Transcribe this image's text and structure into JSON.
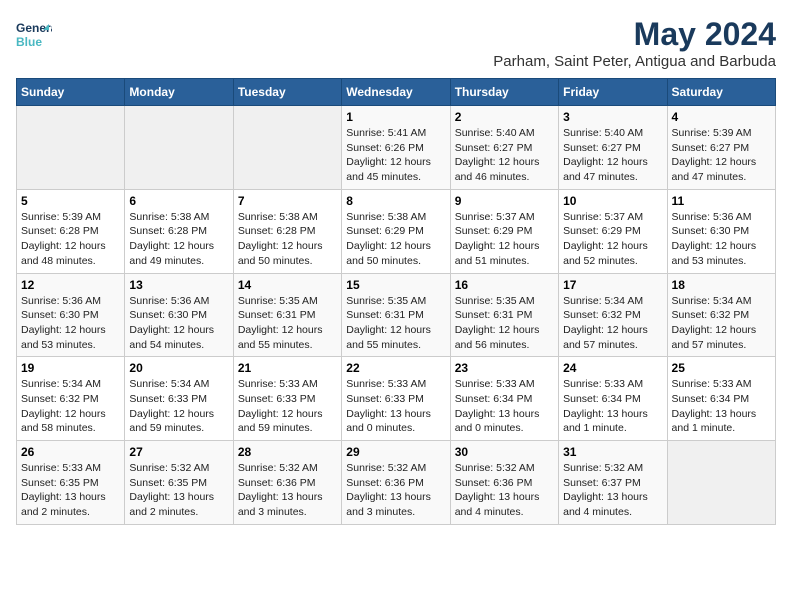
{
  "logo": {
    "line1": "General",
    "line2": "Blue"
  },
  "title": "May 2024",
  "location": "Parham, Saint Peter, Antigua and Barbuda",
  "days_of_week": [
    "Sunday",
    "Monday",
    "Tuesday",
    "Wednesday",
    "Thursday",
    "Friday",
    "Saturday"
  ],
  "weeks": [
    [
      {
        "day": "",
        "info": ""
      },
      {
        "day": "",
        "info": ""
      },
      {
        "day": "",
        "info": ""
      },
      {
        "day": "1",
        "info": "Sunrise: 5:41 AM\nSunset: 6:26 PM\nDaylight: 12 hours\nand 45 minutes."
      },
      {
        "day": "2",
        "info": "Sunrise: 5:40 AM\nSunset: 6:27 PM\nDaylight: 12 hours\nand 46 minutes."
      },
      {
        "day": "3",
        "info": "Sunrise: 5:40 AM\nSunset: 6:27 PM\nDaylight: 12 hours\nand 47 minutes."
      },
      {
        "day": "4",
        "info": "Sunrise: 5:39 AM\nSunset: 6:27 PM\nDaylight: 12 hours\nand 47 minutes."
      }
    ],
    [
      {
        "day": "5",
        "info": "Sunrise: 5:39 AM\nSunset: 6:28 PM\nDaylight: 12 hours\nand 48 minutes."
      },
      {
        "day": "6",
        "info": "Sunrise: 5:38 AM\nSunset: 6:28 PM\nDaylight: 12 hours\nand 49 minutes."
      },
      {
        "day": "7",
        "info": "Sunrise: 5:38 AM\nSunset: 6:28 PM\nDaylight: 12 hours\nand 50 minutes."
      },
      {
        "day": "8",
        "info": "Sunrise: 5:38 AM\nSunset: 6:29 PM\nDaylight: 12 hours\nand 50 minutes."
      },
      {
        "day": "9",
        "info": "Sunrise: 5:37 AM\nSunset: 6:29 PM\nDaylight: 12 hours\nand 51 minutes."
      },
      {
        "day": "10",
        "info": "Sunrise: 5:37 AM\nSunset: 6:29 PM\nDaylight: 12 hours\nand 52 minutes."
      },
      {
        "day": "11",
        "info": "Sunrise: 5:36 AM\nSunset: 6:30 PM\nDaylight: 12 hours\nand 53 minutes."
      }
    ],
    [
      {
        "day": "12",
        "info": "Sunrise: 5:36 AM\nSunset: 6:30 PM\nDaylight: 12 hours\nand 53 minutes."
      },
      {
        "day": "13",
        "info": "Sunrise: 5:36 AM\nSunset: 6:30 PM\nDaylight: 12 hours\nand 54 minutes."
      },
      {
        "day": "14",
        "info": "Sunrise: 5:35 AM\nSunset: 6:31 PM\nDaylight: 12 hours\nand 55 minutes."
      },
      {
        "day": "15",
        "info": "Sunrise: 5:35 AM\nSunset: 6:31 PM\nDaylight: 12 hours\nand 55 minutes."
      },
      {
        "day": "16",
        "info": "Sunrise: 5:35 AM\nSunset: 6:31 PM\nDaylight: 12 hours\nand 56 minutes."
      },
      {
        "day": "17",
        "info": "Sunrise: 5:34 AM\nSunset: 6:32 PM\nDaylight: 12 hours\nand 57 minutes."
      },
      {
        "day": "18",
        "info": "Sunrise: 5:34 AM\nSunset: 6:32 PM\nDaylight: 12 hours\nand 57 minutes."
      }
    ],
    [
      {
        "day": "19",
        "info": "Sunrise: 5:34 AM\nSunset: 6:32 PM\nDaylight: 12 hours\nand 58 minutes."
      },
      {
        "day": "20",
        "info": "Sunrise: 5:34 AM\nSunset: 6:33 PM\nDaylight: 12 hours\nand 59 minutes."
      },
      {
        "day": "21",
        "info": "Sunrise: 5:33 AM\nSunset: 6:33 PM\nDaylight: 12 hours\nand 59 minutes."
      },
      {
        "day": "22",
        "info": "Sunrise: 5:33 AM\nSunset: 6:33 PM\nDaylight: 13 hours\nand 0 minutes."
      },
      {
        "day": "23",
        "info": "Sunrise: 5:33 AM\nSunset: 6:34 PM\nDaylight: 13 hours\nand 0 minutes."
      },
      {
        "day": "24",
        "info": "Sunrise: 5:33 AM\nSunset: 6:34 PM\nDaylight: 13 hours\nand 1 minute."
      },
      {
        "day": "25",
        "info": "Sunrise: 5:33 AM\nSunset: 6:34 PM\nDaylight: 13 hours\nand 1 minute."
      }
    ],
    [
      {
        "day": "26",
        "info": "Sunrise: 5:33 AM\nSunset: 6:35 PM\nDaylight: 13 hours\nand 2 minutes."
      },
      {
        "day": "27",
        "info": "Sunrise: 5:32 AM\nSunset: 6:35 PM\nDaylight: 13 hours\nand 2 minutes."
      },
      {
        "day": "28",
        "info": "Sunrise: 5:32 AM\nSunset: 6:36 PM\nDaylight: 13 hours\nand 3 minutes."
      },
      {
        "day": "29",
        "info": "Sunrise: 5:32 AM\nSunset: 6:36 PM\nDaylight: 13 hours\nand 3 minutes."
      },
      {
        "day": "30",
        "info": "Sunrise: 5:32 AM\nSunset: 6:36 PM\nDaylight: 13 hours\nand 4 minutes."
      },
      {
        "day": "31",
        "info": "Sunrise: 5:32 AM\nSunset: 6:37 PM\nDaylight: 13 hours\nand 4 minutes."
      },
      {
        "day": "",
        "info": ""
      }
    ]
  ]
}
